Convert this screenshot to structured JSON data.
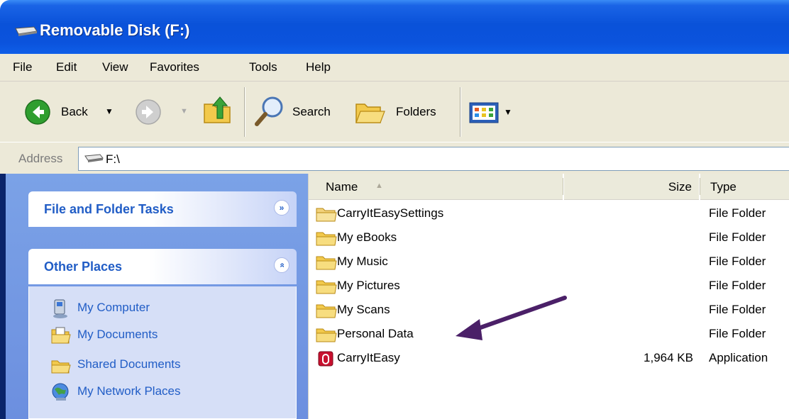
{
  "window": {
    "title": "Removable Disk (F:)"
  },
  "menu": {
    "items": [
      "File",
      "Edit",
      "View",
      "Favorites",
      "Tools",
      "Help"
    ]
  },
  "toolbar": {
    "back_label": "Back",
    "search_label": "Search",
    "folders_label": "Folders"
  },
  "address": {
    "label": "Address",
    "value": "F:\\"
  },
  "sidebar": {
    "tasks_title": "File and Folder Tasks",
    "places_title": "Other Places",
    "places": [
      {
        "label": "My Computer",
        "icon": "computer-icon"
      },
      {
        "label": "My Documents",
        "icon": "documents-folder-icon"
      },
      {
        "label": "Shared Documents",
        "icon": "shared-folder-icon"
      },
      {
        "label": "My Network Places",
        "icon": "network-icon"
      }
    ]
  },
  "columns": {
    "name": "Name",
    "size": "Size",
    "type": "Type"
  },
  "files": [
    {
      "name": "CarryItEasySettings",
      "size": "",
      "type": "File Folder",
      "icon": "folder-icon"
    },
    {
      "name": "My eBooks",
      "size": "",
      "type": "File Folder",
      "icon": "folder-icon"
    },
    {
      "name": "My Music",
      "size": "",
      "type": "File Folder",
      "icon": "folder-icon"
    },
    {
      "name": "My Pictures",
      "size": "",
      "type": "File Folder",
      "icon": "folder-icon"
    },
    {
      "name": "My Scans",
      "size": "",
      "type": "File Folder",
      "icon": "folder-icon"
    },
    {
      "name": "Personal Data",
      "size": "",
      "type": "File Folder",
      "icon": "folder-icon"
    },
    {
      "name": "CarryItEasy",
      "size": "1,964 KB",
      "type": "Application",
      "icon": "application-icon"
    }
  ],
  "colors": {
    "titlebar": "#0a52d9",
    "task_header_text": "#215dc6",
    "sidebar_bg": "#7ba2e7",
    "arrow": "#4b2068"
  }
}
